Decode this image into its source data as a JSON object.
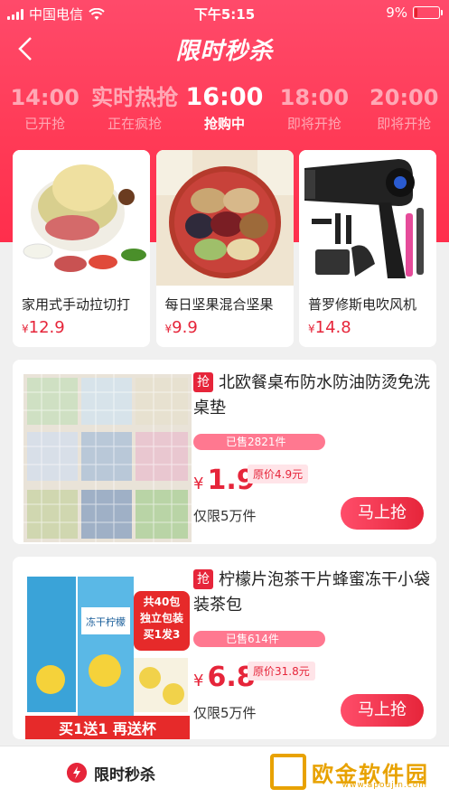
{
  "status": {
    "carrier": "中国电信",
    "time": "下午5:15",
    "battery": "9%"
  },
  "nav": {
    "back_icon": "chevron-left-icon",
    "title": "限时秒杀"
  },
  "tabs": [
    {
      "time": "14:00",
      "status": "已开抢"
    },
    {
      "time": "实时热抢",
      "status": "正在疯抢"
    },
    {
      "time": "16:00",
      "status": "抢购中"
    },
    {
      "time": "18:00",
      "status": "即将开抢"
    },
    {
      "time": "20:00",
      "status": "即将开抢"
    }
  ],
  "featured": [
    {
      "name": "家用式手动拉切打",
      "price": "12.9",
      "currency": "¥"
    },
    {
      "name": "每日坚果混合坚果",
      "price": "9.9",
      "currency": "¥"
    },
    {
      "name": "普罗修斯电吹风机",
      "price": "14.8",
      "currency": "¥"
    }
  ],
  "items": [
    {
      "badge": "抢",
      "title": "北欧餐桌布防水防油防烫免洗桌垫",
      "sold": "已售2821件",
      "currency": "¥",
      "price": "1.9",
      "original": "原价4.9元",
      "limit": "仅限5万件",
      "buy": "马上抢"
    },
    {
      "badge": "抢",
      "title": "柠檬片泡茶干片蜂蜜冻干小袋装茶包",
      "sold": "已售614件",
      "currency": "¥",
      "price": "6.8",
      "original": "原价31.8元",
      "limit": "仅限5万件",
      "buy": "马上抢",
      "image_text": {
        "tag1": "共40包",
        "tag2": "独立包装",
        "tag3": "买1发3",
        "box": "冻干柠檬",
        "bottom": "买1送1 再送杯"
      }
    }
  ],
  "bottom": {
    "label": "限时秒杀",
    "icon": "flash-icon"
  },
  "watermark": {
    "text": "欧金软件园",
    "url": "www.apoujin.com"
  }
}
